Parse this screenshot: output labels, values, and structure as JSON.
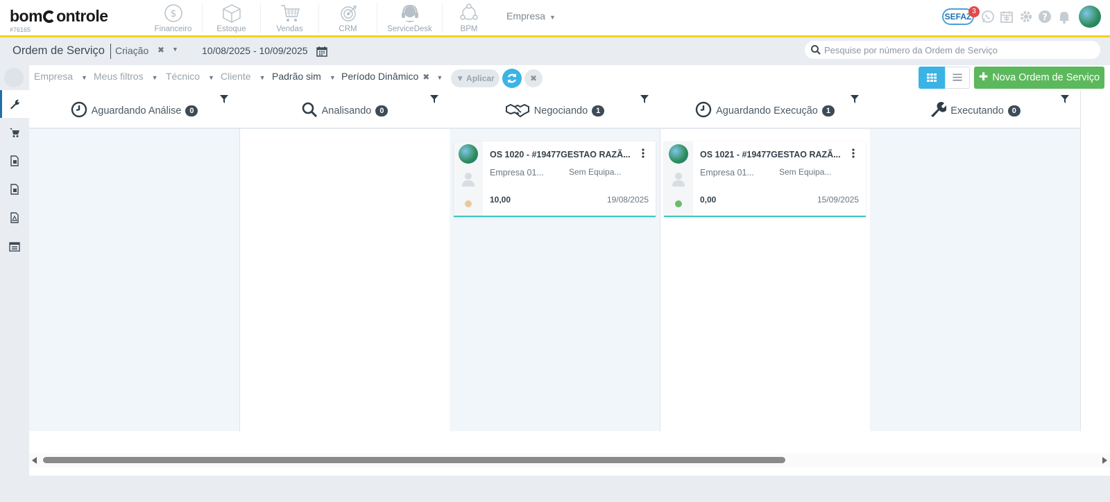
{
  "brand": {
    "name_pre": "bom",
    "name_post": "ontrole",
    "account_id": "#76165"
  },
  "modules": [
    {
      "label": "Financeiro",
      "icon": "dollar-circle-icon"
    },
    {
      "label": "Estoque",
      "icon": "box-icon"
    },
    {
      "label": "Vendas",
      "icon": "cart-icon"
    },
    {
      "label": "CRM",
      "icon": "target-icon"
    },
    {
      "label": "ServiceDesk",
      "icon": "headset-icon"
    },
    {
      "label": "BPM",
      "icon": "flow-icon"
    }
  ],
  "company_selector": {
    "label": "Empresa"
  },
  "notifications": {
    "sefaz_label": "SEFAZ",
    "sefaz_count": "3"
  },
  "page": {
    "title": "Ordem de Serviço",
    "date_type": "Criação",
    "date_range": "10/08/2025 - 10/09/2025"
  },
  "search": {
    "placeholder": "Pesquise por número da Ordem de Serviço"
  },
  "filters": {
    "empresa": "Empresa",
    "meus_filtros": "Meus filtros",
    "tecnico": "Técnico",
    "cliente": "Cliente",
    "padrao": "Padrão sim",
    "periodo": "Período Dinâmico",
    "apply_label": "Aplicar"
  },
  "actions": {
    "new_order_label": "Nova Ordem de Serviço"
  },
  "columns": [
    {
      "title": "Aguardando Análise",
      "count": "0"
    },
    {
      "title": "Analisando",
      "count": "0"
    },
    {
      "title": "Negociando",
      "count": "1"
    },
    {
      "title": "Aguardando Execução",
      "count": "1"
    },
    {
      "title": "Executando",
      "count": "0"
    }
  ],
  "cards": [
    {
      "title": "OS 1020 - #19477GESTAO RAZÃ...",
      "empresa": "Empresa 01...",
      "equipamento": "Sem Equipa...",
      "valor": "10,00",
      "data": "19/08/2025",
      "status_color": "#e8c99a"
    },
    {
      "title": "OS 1021 - #19477GESTAO RAZÃ...",
      "empresa": "Empresa 01...",
      "equipamento": "Sem Equipa...",
      "valor": "0,00",
      "data": "15/09/2025",
      "status_color": "#6dbb6d"
    }
  ],
  "colors": {
    "accent": "#3bb4e5",
    "brand_yellow": "#f5d400",
    "success": "#5cb85c",
    "badge": "#3e4b57"
  }
}
